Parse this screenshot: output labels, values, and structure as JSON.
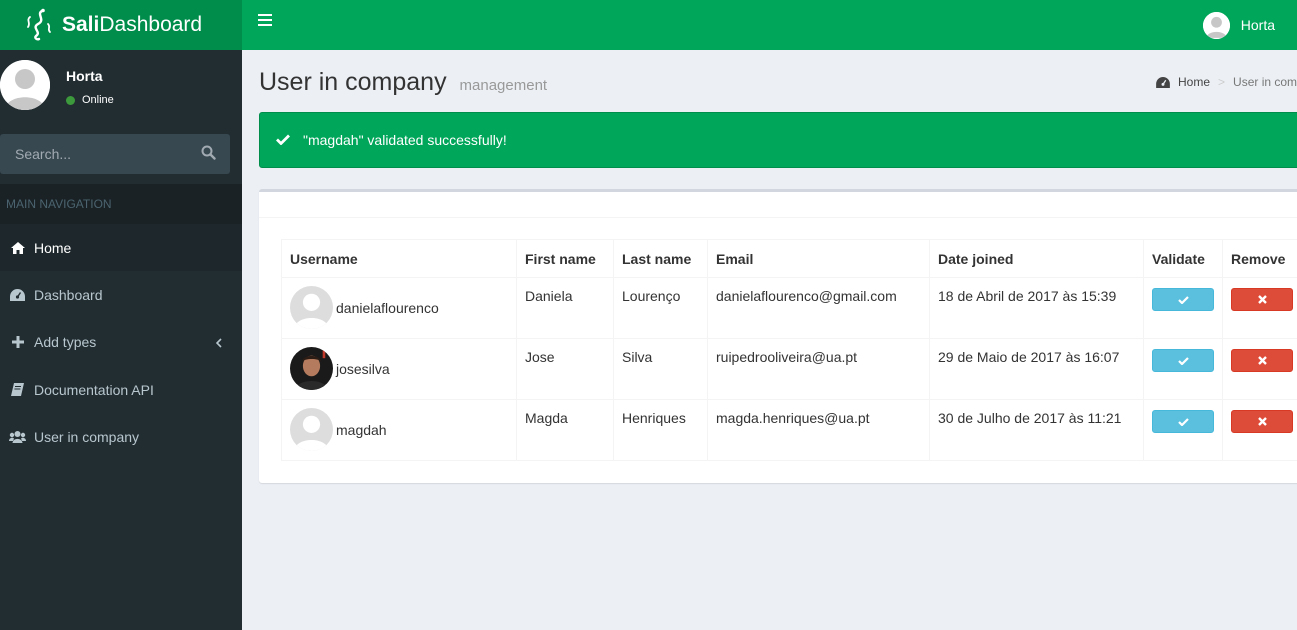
{
  "app": {
    "logo_bold": "Sali",
    "logo_rest": "Dashboard"
  },
  "header": {
    "user_name": "Horta"
  },
  "sidebar": {
    "user_name": "Horta",
    "status": "Online",
    "search_placeholder": "Search...",
    "nav_header": "MAIN NAVIGATION",
    "items": [
      {
        "label": "Home",
        "icon": "home-icon",
        "active": true
      },
      {
        "label": "Dashboard",
        "icon": "dashboard-icon"
      },
      {
        "label": "Add types",
        "icon": "plus-icon",
        "has_chevron": true
      },
      {
        "label": "Documentation API",
        "icon": "book-icon"
      },
      {
        "label": "User in company",
        "icon": "users-icon"
      }
    ]
  },
  "page": {
    "title": "User in company",
    "subtitle": "management",
    "breadcrumb": {
      "home": "Home",
      "current": "User in comp"
    }
  },
  "alert": {
    "message": "\"magdah\" validated successfully!"
  },
  "table": {
    "headers": [
      "Username",
      "First name",
      "Last name",
      "Email",
      "Date joined",
      "Validate",
      "Remove"
    ],
    "rows": [
      {
        "username": "danielaflourenco",
        "avatar": "default",
        "first": "Daniela",
        "last": "Lourenço",
        "email": "danielaflourenco@gmail.com",
        "joined": "18 de Abril de 2017 às 15:39"
      },
      {
        "username": "josesilva",
        "avatar": "photo",
        "first": "Jose",
        "last": "Silva",
        "email": "ruipedrooliveira@ua.pt",
        "joined": "29 de Maio de 2017 às 16:07"
      },
      {
        "username": "magdah",
        "avatar": "default",
        "first": "Magda",
        "last": "Henriques",
        "email": "magda.henriques@ua.pt",
        "joined": "30 de Julho de 2017 às 11:21"
      }
    ]
  },
  "colors": {
    "header": "#00a65a",
    "logo_bg": "#008d4c",
    "sidebar": "#222d32",
    "validate_btn": "#5bc0de",
    "remove_btn": "#dd4b39"
  }
}
